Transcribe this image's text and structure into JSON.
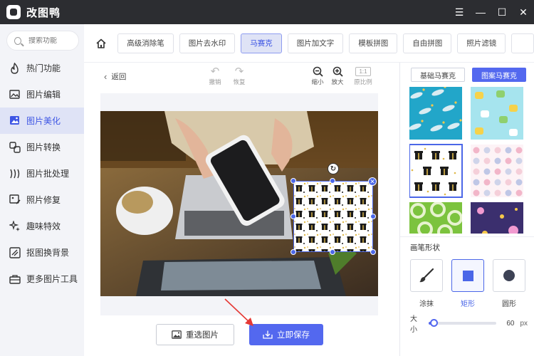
{
  "app": {
    "title": "改图鸭"
  },
  "window_controls": {
    "menu": "☰",
    "minimize": "—",
    "maximize": "☐",
    "close": "✕"
  },
  "search": {
    "placeholder": "搜索功能"
  },
  "sidebar": {
    "active_index": 2,
    "items": [
      {
        "label": "热门功能",
        "icon": "flame-icon"
      },
      {
        "label": "图片编辑",
        "icon": "image-edit-icon"
      },
      {
        "label": "图片美化",
        "icon": "image-beautify-icon"
      },
      {
        "label": "图片转换",
        "icon": "convert-icon"
      },
      {
        "label": "图片批处理",
        "icon": "batch-icon"
      },
      {
        "label": "照片修复",
        "icon": "photo-repair-icon"
      },
      {
        "label": "趣味特效",
        "icon": "sparkle-icon"
      },
      {
        "label": "抠图换背景",
        "icon": "cutout-icon"
      },
      {
        "label": "更多图片工具",
        "icon": "toolbox-icon"
      }
    ]
  },
  "tabs": {
    "active_index": 2,
    "items": [
      "高级消除笔",
      "图片去水印",
      "马赛克",
      "图片加文字",
      "模板拼图",
      "自由拼图",
      "照片滤镜"
    ]
  },
  "toolbar": {
    "back": "返回",
    "undo": "撤销",
    "redo": "恢复",
    "zoom_out": "缩小",
    "zoom_in": "放大",
    "ratio_box": "1:1",
    "ratio": "原比例"
  },
  "actions": {
    "reselect": "重选图片",
    "save": "立即保存"
  },
  "mosaic_panel": {
    "subtabs": [
      "基础马赛克",
      "图案马赛克"
    ],
    "active_subtab": 1,
    "selected_pattern": 2,
    "patterns": [
      {
        "name": "shark-ocean-pattern",
        "bg": "#22a6c9"
      },
      {
        "name": "baby-toys-pattern",
        "bg": "#a6e4ee"
      },
      {
        "name": "gift-box-pattern",
        "bg": "#ffffff"
      },
      {
        "name": "pastel-dots-pattern",
        "bg": "#fdf3f6"
      },
      {
        "name": "green-rings-pattern",
        "bg": "#7cc33e"
      },
      {
        "name": "purple-dots-pattern",
        "bg": "#3b2f6e"
      }
    ]
  },
  "brush": {
    "title": "画笔形状",
    "shapes": [
      "涂抹",
      "矩形",
      "圆形"
    ],
    "active_shape": 1,
    "size_label": "大小",
    "size_value": "60",
    "size_unit": "px",
    "size_fraction": 0.08
  },
  "colors": {
    "accent": "#5368ef",
    "titlebar": "#2c2d31",
    "sidebar": "#f3f4f8"
  }
}
